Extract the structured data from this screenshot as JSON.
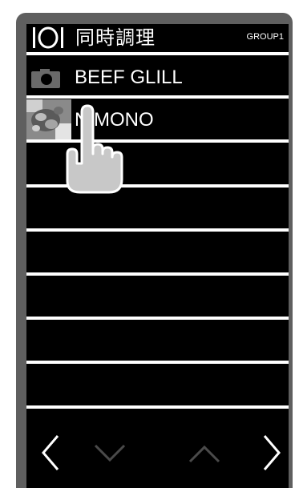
{
  "header": {
    "title": "同時調理",
    "group_label": "GROUP1",
    "icon": "pot-icon"
  },
  "items": [
    {
      "label": "BEEF GLILL",
      "icon": "camera-icon"
    },
    {
      "label": "NIMONO",
      "icon": "food-photo-thumbnail"
    }
  ],
  "empty_rows": 6,
  "nav": {
    "prev_icon": "chevron-left-icon",
    "down_icon": "chevron-down-icon",
    "up_icon": "chevron-up-icon",
    "next_icon": "chevron-right-icon"
  },
  "overlay": {
    "icon": "pointing-hand-icon"
  },
  "colors": {
    "screen_bg": "#000000",
    "text": "#ffffff",
    "device_frame": "#5f5f5f",
    "disabled_arrow": "#4a4a4a"
  }
}
